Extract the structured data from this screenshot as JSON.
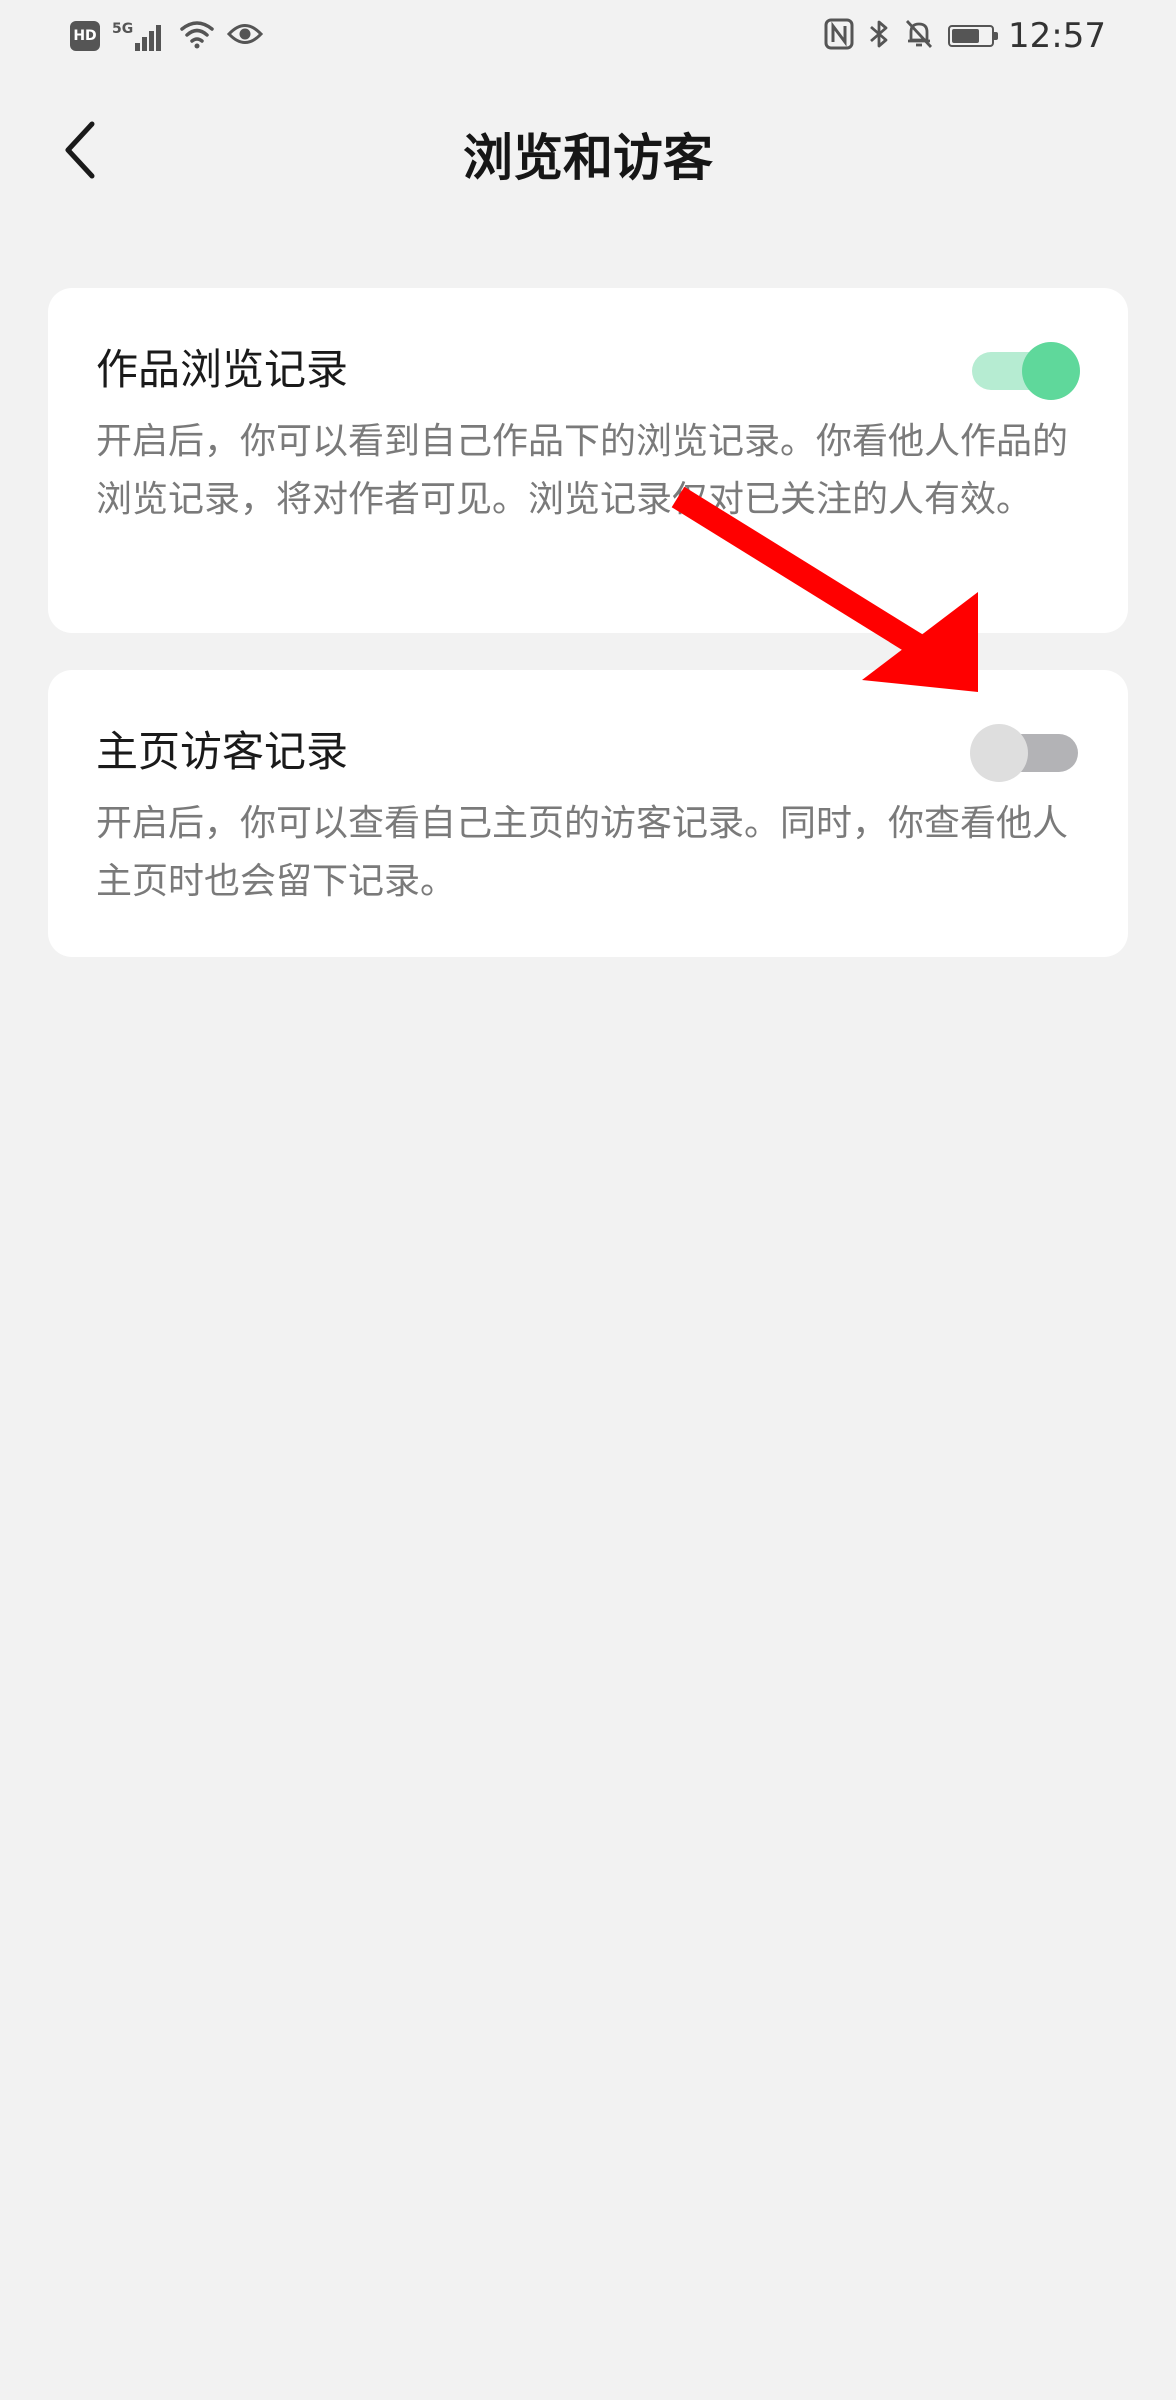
{
  "status_bar": {
    "hd_label": "HD",
    "network_label": "5G",
    "time": "12:57",
    "icons": [
      "hd-icon",
      "signal-icon",
      "wifi-icon",
      "eye-icon",
      "nfc-icon",
      "bluetooth-icon",
      "mute-bell-icon",
      "battery-icon"
    ],
    "battery_level_fraction": 0.7
  },
  "nav": {
    "back_icon": "chevron-left-icon",
    "title": "浏览和访客"
  },
  "settings": [
    {
      "title": "作品浏览记录",
      "description": "开启后，你可以看到自己作品下的浏览记录。你看他人作品的浏览记录，将对作者可见。浏览记录仅对已关注的人有效。",
      "enabled": true
    },
    {
      "title": "主页访客记录",
      "description": "开启后，你可以查看自己主页的访客记录。同时，你查看他人主页时也会留下记录。",
      "enabled": false
    }
  ],
  "colors": {
    "background": "#f2f2f2",
    "card": "#ffffff",
    "toggle_on_knob": "#5fd89b",
    "toggle_on_track": "#b6ecd2",
    "toggle_off_knob": "#dedede",
    "toggle_off_track": "#b3b3b6",
    "annotation_arrow": "#ff0000"
  }
}
